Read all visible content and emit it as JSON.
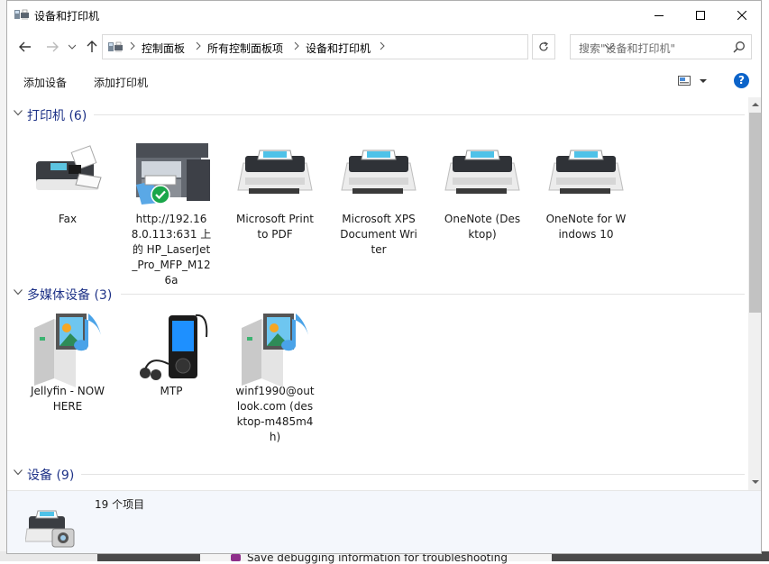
{
  "window": {
    "title": "设备和打印机",
    "controls": {
      "minimize": "minimize",
      "maximize": "maximize",
      "close": "close"
    }
  },
  "address_bar": {
    "breadcrumbs": [
      "控制面板",
      "所有控制面板项",
      "设备和打印机"
    ],
    "search_placeholder": "搜索\"设备和打印机\""
  },
  "toolbar": {
    "add_device": "添加设备",
    "add_printer": "添加打印机",
    "help": "?"
  },
  "groups": {
    "printers": {
      "title": "打印机 (6)",
      "items": [
        {
          "label": "Fax",
          "icon": "fax-icon"
        },
        {
          "label": "http://192.168.0.113:631 上的 HP_LaserJet_Pro_MFP_M126a",
          "icon": "multifunction-printer-icon",
          "default": true
        },
        {
          "label": "Microsoft Print to PDF",
          "icon": "printer-icon"
        },
        {
          "label": "Microsoft XPS Document Writer",
          "icon": "printer-icon"
        },
        {
          "label": "OneNote (Desktop)",
          "icon": "printer-icon"
        },
        {
          "label": "OneNote for Windows 10",
          "icon": "printer-icon"
        }
      ]
    },
    "multimedia": {
      "title": "多媒体设备 (3)",
      "items": [
        {
          "label": "Jellyfin - NOWHERE",
          "icon": "media-server-icon"
        },
        {
          "label": "MTP",
          "icon": "media-player-icon"
        },
        {
          "label": "winf1990@outlook.com (desktop-m485m4h)",
          "icon": "media-server-icon"
        }
      ]
    },
    "devices": {
      "title": "设备 (9)"
    }
  },
  "details": {
    "count": "19 个项目"
  },
  "background": {
    "partial_text": "Save debugging information for troubleshooting"
  },
  "colors": {
    "group_title": "#1e3287",
    "help": "#0b63c9",
    "default_check": "#1aa64a",
    "scroll_thumb": "#c2c2c2"
  }
}
